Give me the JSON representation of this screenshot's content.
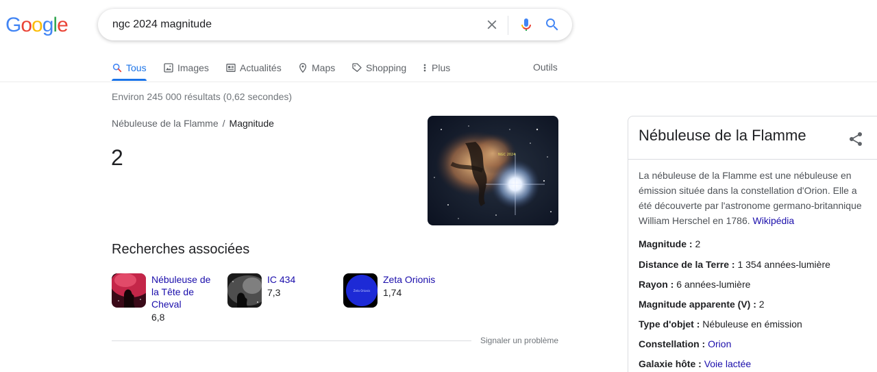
{
  "logo": {
    "letters": [
      "G",
      "o",
      "o",
      "g",
      "l",
      "e"
    ],
    "colors": [
      "#4285f4",
      "#ea4335",
      "#fbbc05",
      "#4285f4",
      "#34a853",
      "#ea4335"
    ]
  },
  "search": {
    "query": "ngc 2024 magnitude"
  },
  "tabs": [
    {
      "label": "Tous",
      "icon": "search-icon",
      "active": true
    },
    {
      "label": "Images",
      "icon": "image-icon"
    },
    {
      "label": "Actualités",
      "icon": "news-icon"
    },
    {
      "label": "Maps",
      "icon": "map-pin-icon"
    },
    {
      "label": "Shopping",
      "icon": "tag-icon"
    },
    {
      "label": "Plus",
      "icon": "more-vert-icon"
    }
  ],
  "tools_label": "Outils",
  "stats": "Environ 245 000 résultats (0,62 secondes)",
  "answer": {
    "breadcrumb_entity": "Nébuleuse de la Flamme",
    "breadcrumb_attribute": "Magnitude",
    "value": "2",
    "image_caption": "NGC 2024"
  },
  "related": {
    "title": "Recherches associées",
    "items": [
      {
        "name": "Nébuleuse de la Tête de Cheval",
        "value": "6,8"
      },
      {
        "name": "IC 434",
        "value": "7,3"
      },
      {
        "name": "Zeta Orionis",
        "value": "1,74",
        "thumb_text": "Zeta Orionis"
      }
    ]
  },
  "report_label": "Signaler un problème",
  "panel": {
    "title": "Nébuleuse de la Flamme",
    "description": "La nébuleuse de la Flamme est une nébuleuse en émission située dans la constellation d'Orion. Elle a été découverte par l'astronome germano-britannique William Herschel en 1786.",
    "source_link": "Wikipédia",
    "facts": [
      {
        "label": "Magnitude :",
        "value": "2",
        "link": false
      },
      {
        "label": "Distance de la Terre :",
        "value": "1 354 années-lumière",
        "link": false
      },
      {
        "label": "Rayon :",
        "value": "6 années-lumière",
        "link": false
      },
      {
        "label": "Magnitude apparente (V) :",
        "value": "2",
        "link": false
      },
      {
        "label": "Type d'objet :",
        "value": "Nébuleuse en émission",
        "link": false
      },
      {
        "label": "Constellation :",
        "value": "Orion",
        "link": true
      },
      {
        "label": "Galaxie hôte :",
        "value": "Voie lactée",
        "link": true
      }
    ]
  }
}
